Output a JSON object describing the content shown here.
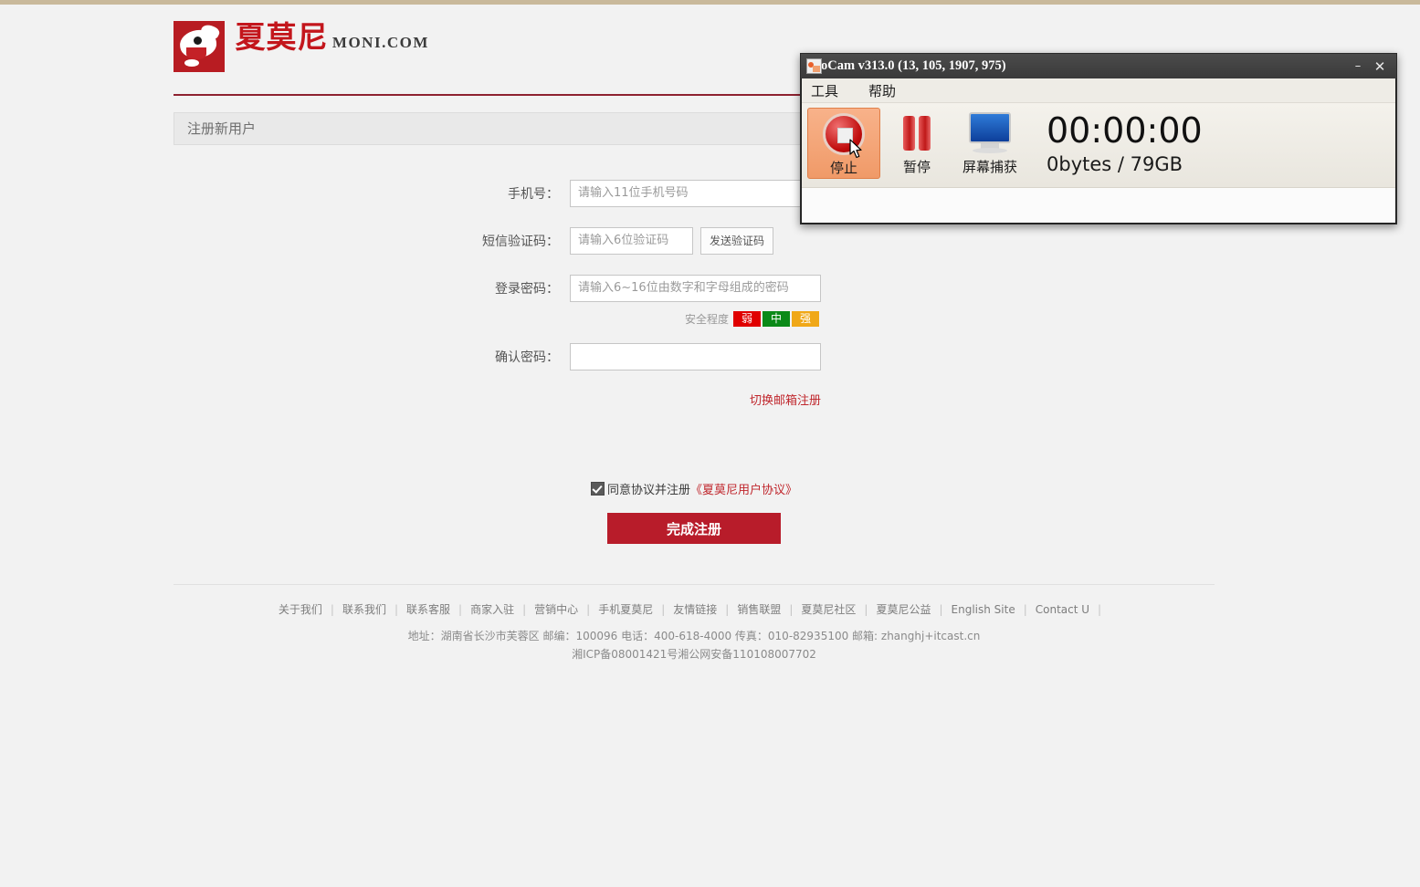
{
  "site": {
    "logo_cn": "夏莫尼",
    "logo_en": "MONI.COM",
    "panel_title": "注册新用户"
  },
  "form": {
    "rows": [
      {
        "label": "手机号：",
        "placeholder": "请输入11位手机号码",
        "value": ""
      },
      {
        "label": "短信验证码：",
        "placeholder": "请输入6位验证码",
        "value": ""
      },
      {
        "label": "登录密码：",
        "placeholder": "请输入6~16位由数字和字母组成的密码",
        "value": ""
      },
      {
        "label": "确认密码：",
        "placeholder": "",
        "value": ""
      }
    ],
    "send_code_label": "发送验证码",
    "strength": {
      "label": "安全程度",
      "weak": "弱",
      "medium": "中",
      "strong": "强",
      "weak_color": "#e00000",
      "medium_color": "#0b8a18",
      "strong_color": "#f0a818"
    },
    "switch_link": "切换邮箱注册",
    "agree_text": "同意协议并注册",
    "agree_link": "《夏莫尼用户协议》",
    "agree_checked": true,
    "submit_label": "完成注册",
    "submit_color": "#b81c2a"
  },
  "footer": {
    "links": [
      "关于我们",
      "联系我们",
      "联系客服",
      "商家入驻",
      "营销中心",
      "手机夏莫尼",
      "友情链接",
      "销售联盟",
      "夏莫尼社区",
      "夏莫尼公益",
      "English Site",
      "Contact U"
    ],
    "separator": "|",
    "address_line": "地址：湖南省长沙市芙蓉区 邮编：100096 电话：400-618-4000 传真：010-82935100 邮箱: zhanghj+itcast.cn",
    "icp_line": "湘ICP备08001421号湘公网安备110108007702"
  },
  "ocam": {
    "title": "oCam v313.0 (13, 105, 1907, 975)",
    "minimize_label": "–",
    "close_label": "✕",
    "menu": [
      "工具",
      "帮助"
    ],
    "toolbar": [
      {
        "label": "停止",
        "icon": "stop-icon",
        "active": true
      },
      {
        "label": "暂停",
        "icon": "pause-icon",
        "active": false
      },
      {
        "label": "屏幕捕获",
        "icon": "monitor-icon",
        "active": false
      }
    ],
    "timer": "00:00:00",
    "size_info": "0bytes / 79GB"
  }
}
